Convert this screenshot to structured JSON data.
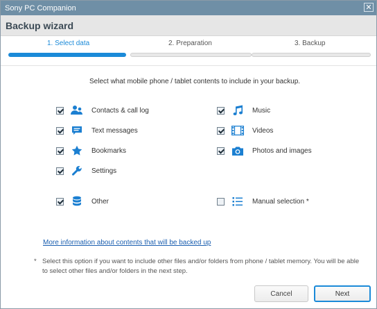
{
  "window": {
    "title": "Sony PC Companion",
    "close_glyph": "✕"
  },
  "header": {
    "title": "Backup wizard"
  },
  "steps": [
    {
      "label": "1. Select data",
      "active": true
    },
    {
      "label": "2. Preparation",
      "active": false
    },
    {
      "label": "3. Backup",
      "active": false
    }
  ],
  "instruction": "Select what mobile phone / tablet contents to include in your backup.",
  "items": {
    "contacts": {
      "label": "Contacts & call log",
      "checked": true,
      "icon": "contacts-icon"
    },
    "messages": {
      "label": "Text messages",
      "checked": true,
      "icon": "message-icon"
    },
    "bookmarks": {
      "label": "Bookmarks",
      "checked": true,
      "icon": "star-icon"
    },
    "settings": {
      "label": "Settings",
      "checked": true,
      "icon": "wrench-icon"
    },
    "other": {
      "label": "Other",
      "checked": true,
      "icon": "database-icon"
    },
    "music": {
      "label": "Music",
      "checked": true,
      "icon": "music-note-icon"
    },
    "videos": {
      "label": "Videos",
      "checked": true,
      "icon": "film-icon"
    },
    "photos": {
      "label": "Photos and images",
      "checked": true,
      "icon": "camera-icon"
    },
    "manual": {
      "label": "Manual selection *",
      "checked": false,
      "icon": "list-icon"
    }
  },
  "link": "More information about contents that will be backed up",
  "footnote": {
    "star": "*",
    "text": "Select this option if you want to include other files and/or folders from phone / tablet memory. You will be able to select other files and/or folders in the next step."
  },
  "buttons": {
    "cancel": "Cancel",
    "next": "Next"
  },
  "colors": {
    "accent": "#1b8ad8",
    "titlebar": "#6f8fa6",
    "header_bg": "#e6e6e6",
    "link": "#1b5fb0"
  }
}
